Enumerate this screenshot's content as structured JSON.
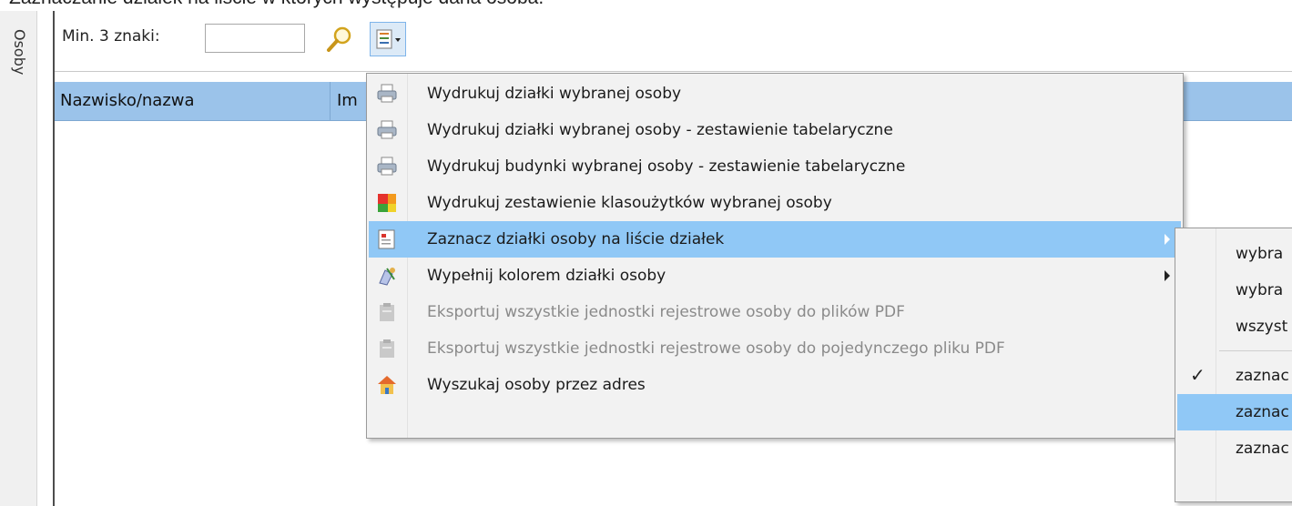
{
  "caption": "Zaznaczanie działek na liście w których występuje dana osoba.",
  "side_tab": {
    "label": "Osoby"
  },
  "toolbar": {
    "min_label": "Min. 3 znaki:",
    "search_value": "",
    "search_icon": "magnifier-icon",
    "menu_icon": "list-dropdown-icon"
  },
  "table": {
    "columns": [
      "Nazwisko/nazwa",
      "Im"
    ]
  },
  "menu": {
    "items": [
      {
        "label": "Wydrukuj działki wybranej osoby",
        "icon": "printer-icon",
        "enabled": true,
        "submenu": false,
        "highlighted": false
      },
      {
        "label": "Wydrukuj działki wybranej osoby - zestawienie tabelaryczne",
        "icon": "printer-icon",
        "enabled": true,
        "submenu": false,
        "highlighted": false
      },
      {
        "label": "Wydrukuj budynki wybranej osoby - zestawienie tabelaryczne",
        "icon": "printer-icon",
        "enabled": true,
        "submenu": false,
        "highlighted": false
      },
      {
        "label": "Wydrukuj zestawienie klasoużytków wybranej osoby",
        "icon": "color-blocks-icon",
        "enabled": true,
        "submenu": false,
        "highlighted": false
      },
      {
        "label": "Zaznacz działki osoby na liście działek",
        "icon": "document-icon",
        "enabled": true,
        "submenu": true,
        "highlighted": true
      },
      {
        "label": "Wypełnij kolorem działki osoby",
        "icon": "paint-icon",
        "enabled": true,
        "submenu": true,
        "highlighted": false
      },
      {
        "label": "Eksportuj wszystkie jednostki rejestrowe osoby do plików PDF",
        "icon": "export-icon",
        "enabled": false,
        "submenu": false,
        "highlighted": false
      },
      {
        "label": "Eksportuj wszystkie jednostki rejestrowe osoby do pojedynczego pliku PDF",
        "icon": "export-icon",
        "enabled": false,
        "submenu": false,
        "highlighted": false
      },
      {
        "label": "Wyszukaj osoby przez adres",
        "icon": "house-icon",
        "enabled": true,
        "submenu": false,
        "highlighted": false
      }
    ]
  },
  "submenu": {
    "items": [
      {
        "label": "wybra",
        "checked": false,
        "highlighted": false
      },
      {
        "label": "wybra",
        "checked": false,
        "highlighted": false
      },
      {
        "label": "wszyst",
        "checked": false,
        "highlighted": false
      },
      {
        "label": "zaznac",
        "checked": true,
        "highlighted": false
      },
      {
        "label": "zaznac",
        "checked": false,
        "highlighted": true
      },
      {
        "label": "zaznac",
        "checked": false,
        "highlighted": false
      }
    ]
  },
  "colors": {
    "highlight": "#90c8f6",
    "header": "#9bc3ea",
    "menu_bg": "#f2f2f2",
    "disabled_text": "#8a8a8a"
  }
}
